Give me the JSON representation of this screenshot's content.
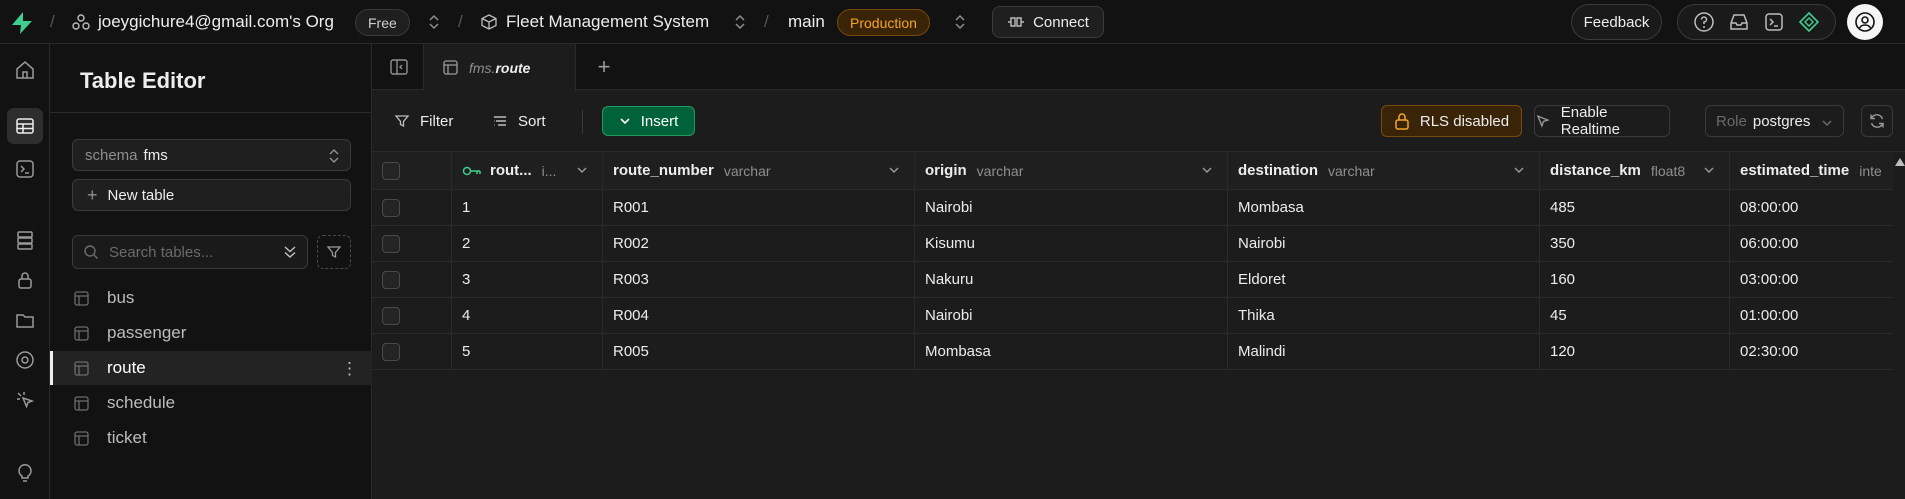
{
  "topbar": {
    "org_name": "joeygichure4@gmail.com's Org",
    "org_plan": "Free",
    "project_name": "Fleet Management System",
    "branch": "main",
    "env_badge": "Production",
    "connect_label": "Connect",
    "feedback_label": "Feedback"
  },
  "sidebar": {
    "title": "Table Editor",
    "schema_key": "schema",
    "schema_value": "fms",
    "new_table_label": "New table",
    "search_placeholder": "Search tables...",
    "tables": [
      "bus",
      "passenger",
      "route",
      "schedule",
      "ticket"
    ],
    "active_table": "route"
  },
  "tab": {
    "schema": "fms.",
    "name": "route"
  },
  "toolbar": {
    "filter_label": "Filter",
    "sort_label": "Sort",
    "insert_label": "Insert",
    "rls_label": "RLS disabled",
    "realtime_label": "Enable Realtime",
    "role_key": "Role",
    "role_value": "postgres"
  },
  "grid": {
    "columns": [
      {
        "name": "rout...",
        "type": "i..."
      },
      {
        "name": "route_number",
        "type": "varchar"
      },
      {
        "name": "origin",
        "type": "varchar"
      },
      {
        "name": "destination",
        "type": "varchar"
      },
      {
        "name": "distance_km",
        "type": "float8"
      },
      {
        "name": "estimated_time",
        "type": "inte"
      }
    ],
    "rows": [
      [
        "1",
        "R001",
        "Nairobi",
        "Mombasa",
        "485",
        "08:00:00"
      ],
      [
        "2",
        "R002",
        "Kisumu",
        "Nairobi",
        "350",
        "06:00:00"
      ],
      [
        "3",
        "R003",
        "Nakuru",
        "Eldoret",
        "160",
        "03:00:00"
      ],
      [
        "4",
        "R004",
        "Nairobi",
        "Thika",
        "45",
        "01:00:00"
      ],
      [
        "5",
        "R005",
        "Mombasa",
        "Malindi",
        "120",
        "02:30:00"
      ]
    ]
  },
  "colors": {
    "accent_green": "#3ecf8e",
    "insert_green": "#006239",
    "warning_orange": "#f5a524"
  }
}
